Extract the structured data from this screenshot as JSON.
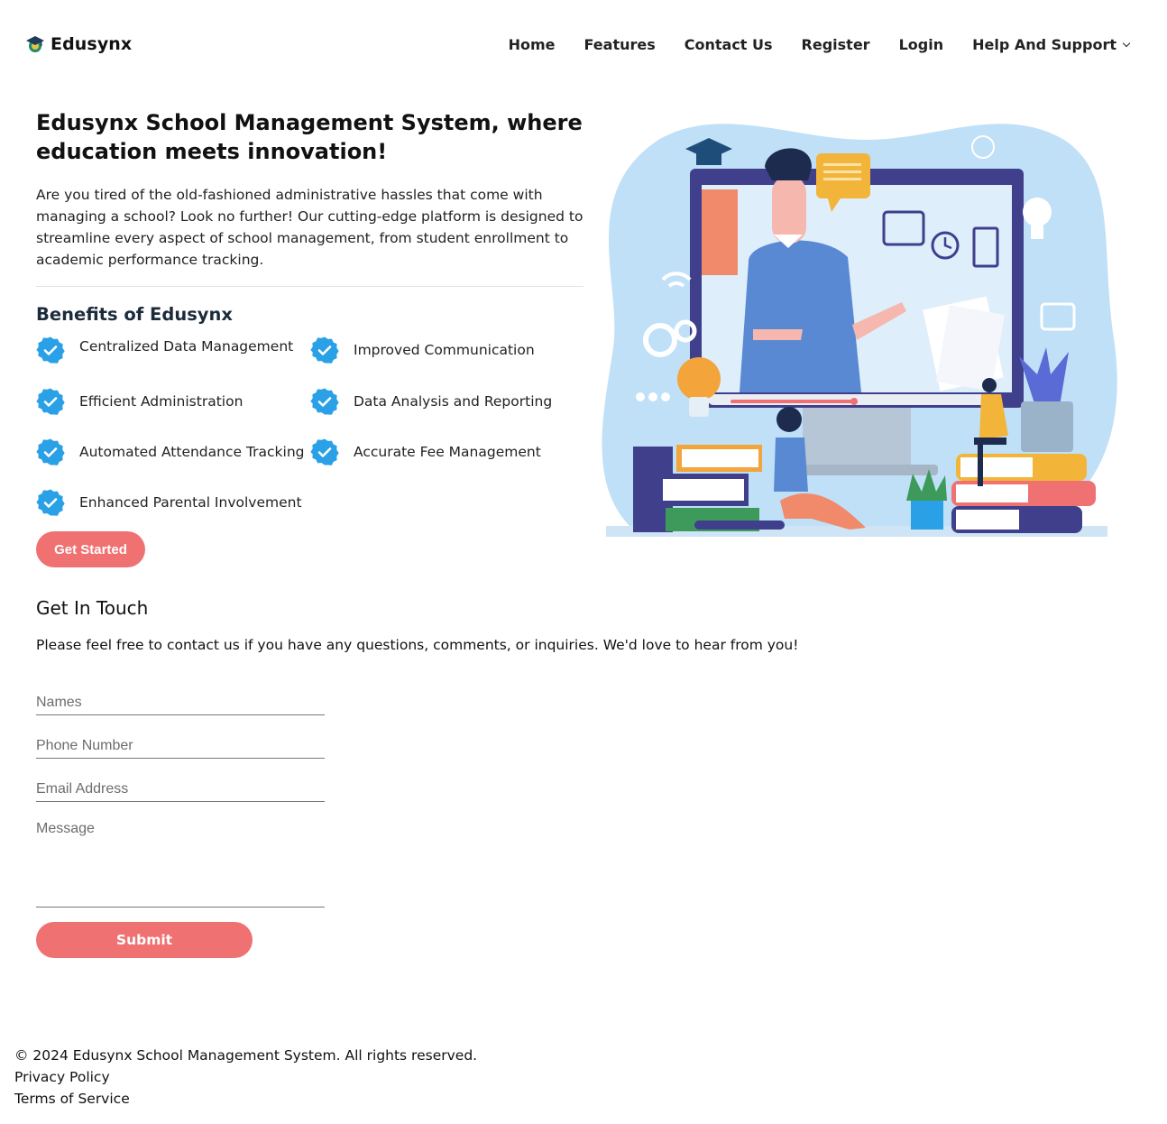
{
  "header": {
    "brand": "Edusynx",
    "nav": [
      {
        "label": "Home"
      },
      {
        "label": "Features"
      },
      {
        "label": "Contact Us"
      },
      {
        "label": "Register"
      },
      {
        "label": "Login"
      },
      {
        "label": "Help And Support",
        "icon": "chevron-down-icon"
      }
    ]
  },
  "hero": {
    "title": "Edusynx School Management System, where education meets innovation!",
    "description": "Are you tired of the old-fashioned administrative hassles that come with managing a school? Look no further! Our cutting-edge platform is designed to streamline every aspect of school management, from student enrollment to academic performance tracking.",
    "benefits_title": "Benefits of Edusynx",
    "benefits": [
      "Centralized Data Management",
      "Improved Communication",
      "Efficient Administration",
      "Data Analysis and Reporting",
      "Automated Attendance Tracking",
      "Accurate Fee Management",
      "Enhanced Parental Involvement"
    ],
    "cta_label": "Get Started"
  },
  "contact": {
    "title": "Get In Touch",
    "description": "Please feel free to contact us if you have any questions, comments, or inquiries. We'd love to hear from you!",
    "names_placeholder": "Names",
    "phone_placeholder": "Phone Number",
    "email_placeholder": "Email Address",
    "message_placeholder": "Message",
    "submit_label": "Submit"
  },
  "footer": {
    "copyright": "© 2024 Edusynx School Management System. All rights reserved.",
    "privacy": "Privacy Policy",
    "terms": "Terms of Service"
  },
  "colors": {
    "accent": "#f07171",
    "check": "#2aa1e6",
    "blob": "#bfe0f7"
  }
}
